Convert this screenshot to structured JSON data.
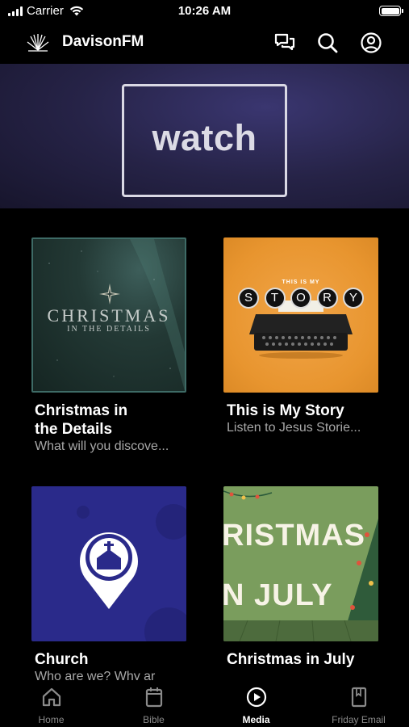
{
  "status": {
    "carrier": "Carrier",
    "time": "10:26 AM"
  },
  "header": {
    "title": "DavisonFM",
    "icons": [
      "chat-bubbles-icon",
      "search-icon",
      "profile-icon"
    ]
  },
  "banner": {
    "text": "watch"
  },
  "cards": [
    {
      "title_line1": "Christmas in",
      "title_line2": "the Details",
      "subtitle": "What will you discove...",
      "art_title": "CHRISTMAS",
      "art_subtitle": "IN THE DETAILS"
    },
    {
      "title_line1": "This is My Story",
      "subtitle": "Listen to Jesus Storie...",
      "art_small": "THIS IS MY",
      "art_letters": [
        "S",
        "T",
        "O",
        "R",
        "Y"
      ]
    },
    {
      "title_line1": "Church",
      "subtitle": "Who are we?  Why ar"
    },
    {
      "title_line1": "Christmas in July",
      "art_line1": "RISTMAS",
      "art_line2": "N JULY"
    }
  ],
  "tabs": [
    {
      "label": "Home",
      "icon": "home-icon"
    },
    {
      "label": "Bible",
      "icon": "book-icon"
    },
    {
      "label": "Media",
      "icon": "play-icon"
    },
    {
      "label": "Friday Email",
      "icon": "bookmark-book-icon"
    }
  ],
  "active_tab": "Media"
}
